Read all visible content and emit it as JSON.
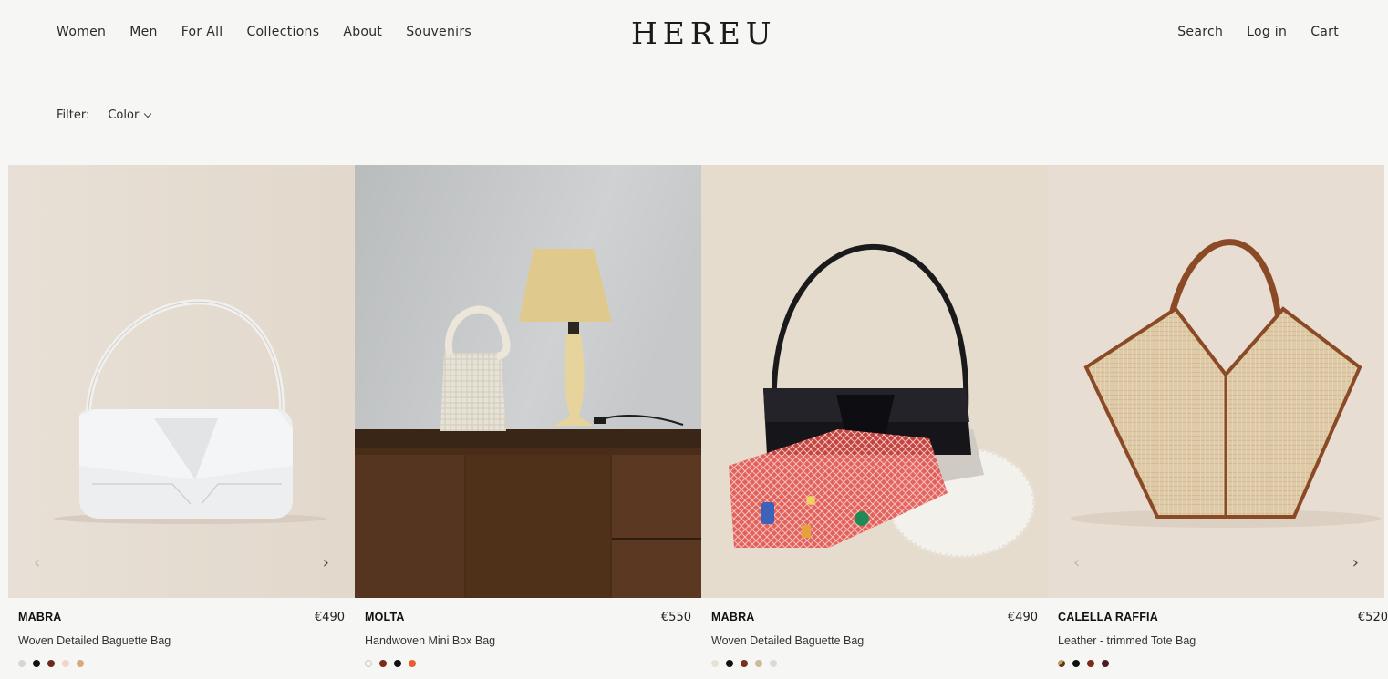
{
  "nav": {
    "left": [
      "Women",
      "Men",
      "For All",
      "Collections",
      "About",
      "Souvenirs"
    ],
    "logo": "HEREU",
    "right": [
      "Search",
      "Log in",
      "Cart"
    ]
  },
  "filter": {
    "label": "Filter:",
    "option": "Color"
  },
  "products": [
    {
      "brand": "MABRA",
      "price": "€490",
      "name": "Woven Detailed Baguette Bag",
      "swatches": [
        "#d9d6d2",
        "#111111",
        "#6b2a1a",
        "#efd6c8",
        "#d9a77e"
      ],
      "arrows": true
    },
    {
      "brand": "MOLTA",
      "price": "€550",
      "name": "Handwoven Mini Box Bag",
      "swatches": [
        "#f0ede8",
        "#7a2b1a",
        "#111111",
        "#e8602c"
      ],
      "arrows": false
    },
    {
      "brand": "MABRA",
      "price": "€490",
      "name": "Woven Detailed Baguette Bag",
      "swatches": [
        "#e8e2d6",
        "#111111",
        "#7a2f1c",
        "#cdb89a",
        "#dcdad6"
      ],
      "arrows": false
    },
    {
      "brand": "CALELLA RAFFIA",
      "price": "€520",
      "name": "Leather - trimmed Tote Bag",
      "swatches": [
        "#b58a52",
        "#111111",
        "#7a2b1a",
        "#4a1e1e"
      ],
      "arrows": true
    }
  ]
}
